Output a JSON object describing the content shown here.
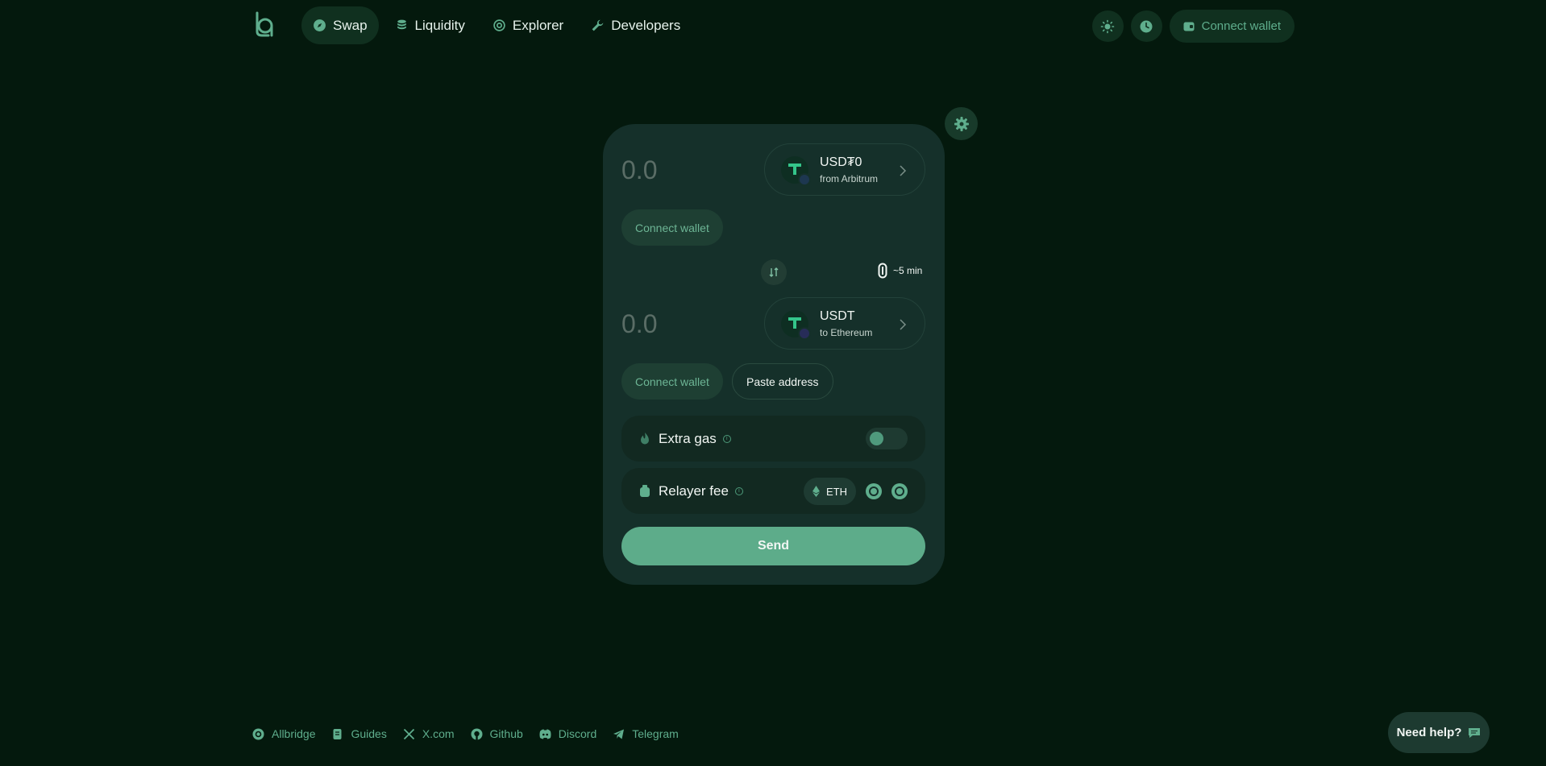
{
  "nav": {
    "items": [
      {
        "label": "Swap",
        "icon": "compass-icon"
      },
      {
        "label": "Liquidity",
        "icon": "coins-stack-icon"
      },
      {
        "label": "Explorer",
        "icon": "explorer-logo-icon"
      },
      {
        "label": "Developers",
        "icon": "wrench-icon"
      }
    ],
    "active": "Swap"
  },
  "header": {
    "theme_icon": "sun-icon",
    "history_icon": "clock-icon",
    "connect_label": "Connect wallet"
  },
  "swap": {
    "from": {
      "amount_placeholder": "0.0",
      "token": "USD₮0",
      "chain": "from Arbitrum",
      "connect_label": "Connect wallet"
    },
    "eta": "~5 min",
    "to": {
      "amount_placeholder": "0.0",
      "token": "USDT",
      "chain": "to Ethereum",
      "connect_label": "Connect wallet",
      "paste_label": "Paste address"
    },
    "extra_gas": {
      "label": "Extra gas",
      "enabled": false
    },
    "relayer_fee": {
      "label": "Relayer fee",
      "selected": "ETH"
    },
    "send_label": "Send"
  },
  "footer": {
    "links": [
      {
        "label": "Allbridge",
        "icon": "allbridge-icon"
      },
      {
        "label": "Guides",
        "icon": "book-icon"
      },
      {
        "label": "X.com",
        "icon": "x-icon"
      },
      {
        "label": "Github",
        "icon": "github-icon"
      },
      {
        "label": "Discord",
        "icon": "discord-icon"
      },
      {
        "label": "Telegram",
        "icon": "telegram-icon"
      }
    ]
  },
  "help": {
    "label": "Need help?"
  },
  "colors": {
    "background": "#04190d",
    "card": "#15302a",
    "accent": "#5dac8a",
    "accent_text": "#5fae8d"
  }
}
